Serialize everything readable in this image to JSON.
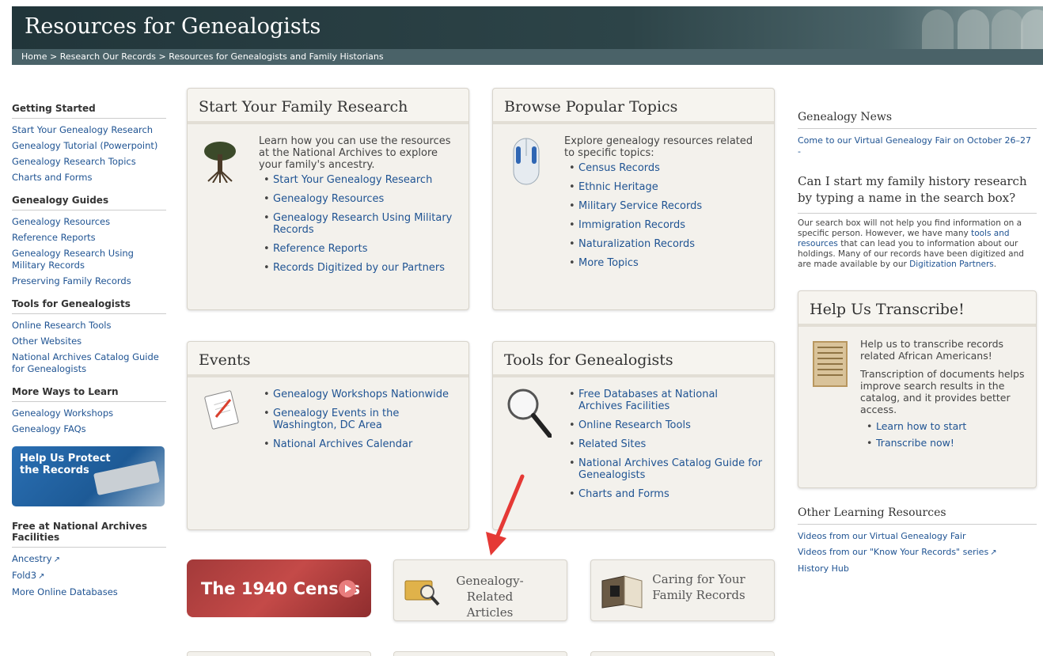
{
  "header": {
    "title": "Resources for Genealogists",
    "breadcrumb": "Home > Research Our Records > Resources for Genealogists and Family Historians"
  },
  "leftnav": {
    "getting_started": {
      "heading": "Getting Started",
      "items": [
        "Start Your Genealogy Research",
        "Genealogy Tutorial (Powerpoint)",
        "Genealogy Research Topics",
        "Charts and Forms"
      ]
    },
    "genealogy_guides": {
      "heading": "Genealogy Guides",
      "items": [
        "Genealogy Resources",
        "Reference Reports",
        "Genealogy Research Using Military Records",
        "Preserving Family Records"
      ]
    },
    "tools": {
      "heading": "Tools for Genealogists",
      "items": [
        "Online Research Tools",
        "Other Websites",
        "National Archives Catalog Guide for Genealogists"
      ]
    },
    "more_ways": {
      "heading": "More Ways to Learn",
      "items": [
        "Genealogy Workshops",
        "Genealogy FAQs"
      ]
    },
    "protect_banner": "Help Us Protect the Records",
    "free_at_archives": {
      "heading": "Free at National Archives Facilities",
      "items": [
        "Ancestry",
        "Fold3",
        "More Online Databases"
      ]
    }
  },
  "boxes": {
    "start_research": {
      "title": "Start Your Family Research",
      "intro": "Learn how you can use the resources at the National Archives to explore your family's ancestry.",
      "items": [
        "Start Your Genealogy Research",
        "Genealogy Resources",
        "Genealogy Research Using Military Records",
        "Reference Reports",
        "Records Digitized by our Partners"
      ]
    },
    "popular_topics": {
      "title": "Browse Popular Topics",
      "intro": "Explore genealogy resources related to specific topics:",
      "items": [
        "Census Records",
        "Ethnic Heritage",
        "Military Service Records",
        "Immigration Records",
        "Naturalization Records",
        "More Topics"
      ]
    },
    "events": {
      "title": "Events",
      "items": [
        "Genealogy Workshops Nationwide",
        "Genealogy Events in the Washington, DC Area",
        "National Archives Calendar"
      ]
    },
    "tools": {
      "title": "Tools for Genealogists",
      "items": [
        "Free Databases at National Archives Facilities",
        "Online Research Tools",
        "Related Sites",
        "National Archives Catalog Guide for Genealogists",
        "Charts and Forms"
      ]
    }
  },
  "tiles": {
    "census": "The 1940 Census",
    "articles": "Genealogy-Related Articles",
    "caring": "Caring for Your Family Records"
  },
  "right": {
    "news_heading": "Genealogy News",
    "news_link": "Come to our Virtual Genealogy Fair on October 26–27 -",
    "question": "Can I start my family history research by typing a name in the search box?",
    "answer_pre": "Our search box will not help you find information on a specific person.  However, we have many ",
    "answer_link1": "tools and resources",
    "answer_mid": " that can lead you to information about our holdings.  Many of our records have been digitized and are made available by our ",
    "answer_link2": "Digitization Partners",
    "answer_post": ".",
    "transcribe": {
      "title": "Help Us Transcribe!",
      "p1": "Help us to transcribe records related African Americans!",
      "p2": "Transcription of documents helps improve search results in the catalog, and it provides better access.",
      "items": [
        "Learn how to start",
        "Transcribe now!"
      ]
    },
    "other_heading": "Other Learning Resources",
    "other_links": [
      "Videos from our Virtual Genealogy Fair",
      "Videos from our \"Know Your Records\" series",
      "History Hub"
    ]
  },
  "icons": {
    "external": "external-link-icon",
    "tree": "tree-icon",
    "mouse": "computer-mouse-icon",
    "notepad": "notepad-icon",
    "magnifier": "magnifier-icon"
  },
  "colors": {
    "link": "#205493",
    "banner": "#2d4448",
    "box_bg": "#f3f1ec",
    "census_red": "#b54140",
    "annotation_arrow": "#e53935"
  }
}
